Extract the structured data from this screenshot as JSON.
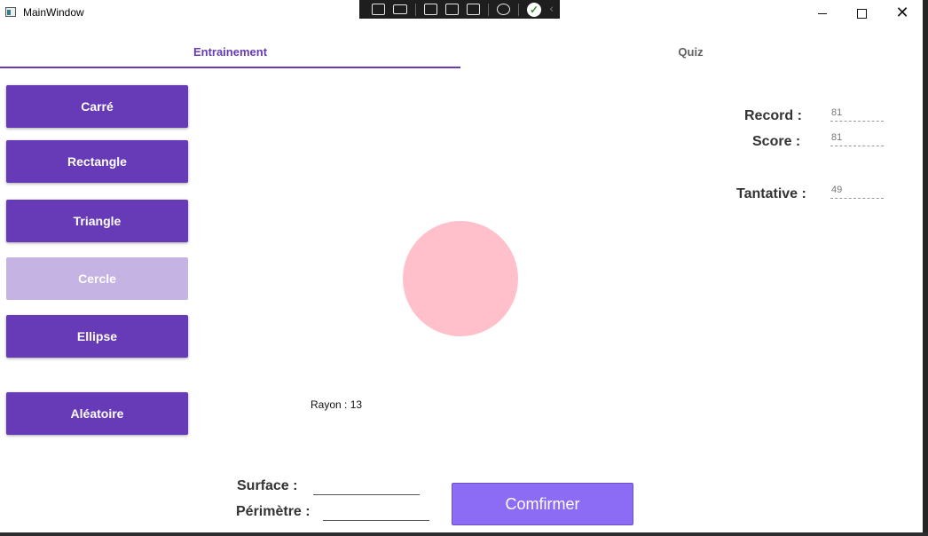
{
  "window": {
    "title": "MainWindow"
  },
  "debug_toolbar": {
    "icons": [
      "live-tree-icon",
      "record-icon",
      "select-element-icon",
      "display-adorners-icon",
      "track-focus-icon",
      "hot-reload-icon",
      "check-icon",
      "chevron-left-icon"
    ]
  },
  "tabs": [
    {
      "label": "Entrainement",
      "selected": true
    },
    {
      "label": "Quiz",
      "selected": false
    }
  ],
  "shapes": {
    "carre": "Carré",
    "rectangle": "Rectangle",
    "triangle": "Triangle",
    "cercle": "Cercle",
    "ellipse": "Ellipse",
    "aleatoire": "Aléatoire"
  },
  "figure": {
    "color": "#ffc0cb",
    "rayon_label": "Rayon : 13"
  },
  "stats": {
    "record_label": "Record :",
    "record_value": "81",
    "score_label": "Score :",
    "score_value": "81",
    "tentative_label": "Tantative :",
    "tentative_value": "49"
  },
  "answer": {
    "surface_label": "Surface :",
    "surface_value": "",
    "perimetre_label": "Périmètre :",
    "perimetre_value": "",
    "confirm_label": "Comfirmer"
  },
  "colors": {
    "accent": "#673ab7",
    "accent_disabled": "#c5b3e3",
    "confirm": "#8c6cf4"
  }
}
